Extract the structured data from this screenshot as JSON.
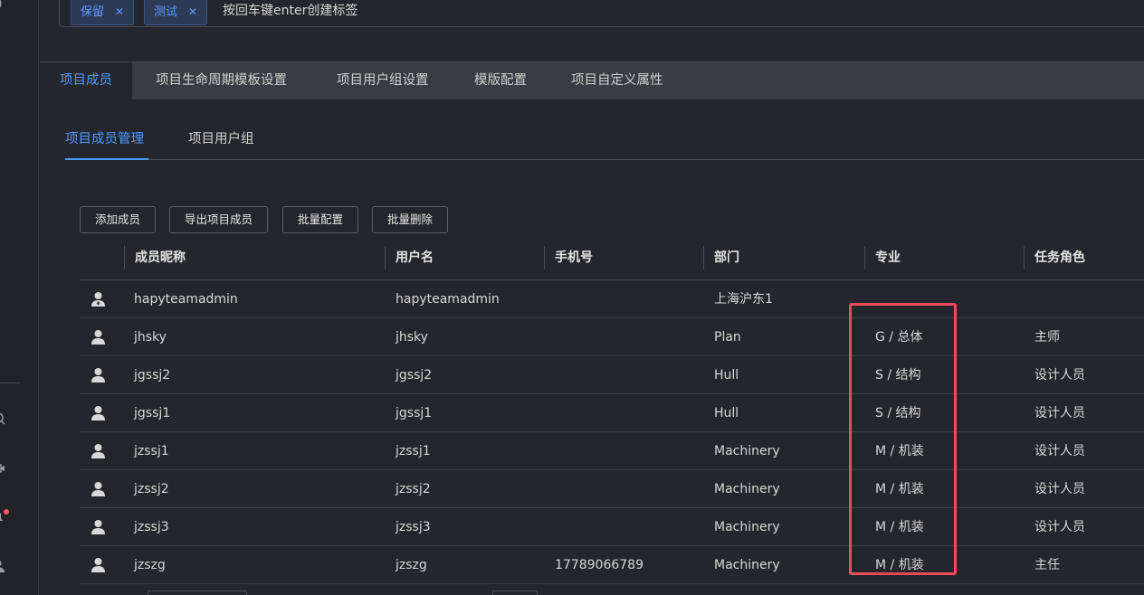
{
  "tags": {
    "items": [
      "保留",
      "测试"
    ],
    "input_placeholder": "按回车键enter创建标签"
  },
  "tabs": [
    "项目成员",
    "项目生命周期模板设置",
    "项目用户组设置",
    "模版配置",
    "项目自定义属性"
  ],
  "subtabs": [
    "项目成员管理",
    "项目用户组"
  ],
  "toolbar": {
    "add": "添加成员",
    "export": "导出项目成员",
    "batch_config": "批量配置",
    "batch_delete": "批量删除"
  },
  "table": {
    "headers": [
      "成员昵称",
      "用户名",
      "手机号",
      "部门",
      "专业",
      "任务角色"
    ],
    "rows": [
      {
        "nickname": "hapyteamadmin",
        "username": "hapyteamadmin",
        "phone": "",
        "dept": "上海沪东1",
        "major": "",
        "role": "",
        "icon": "admin-user-icon"
      },
      {
        "nickname": "jhsky",
        "username": "jhsky",
        "phone": "",
        "dept": "Plan",
        "major": "G / 总体",
        "role": "主师",
        "icon": "user-icon"
      },
      {
        "nickname": "jgssj2",
        "username": "jgssj2",
        "phone": "",
        "dept": "Hull",
        "major": "S / 结构",
        "role": "设计人员",
        "icon": "user-icon"
      },
      {
        "nickname": "jgssj1",
        "username": "jgssj1",
        "phone": "",
        "dept": "Hull",
        "major": "S / 结构",
        "role": "设计人员",
        "icon": "user-icon"
      },
      {
        "nickname": "jzssj1",
        "username": "jzssj1",
        "phone": "",
        "dept": "Machinery",
        "major": "M / 机装",
        "role": "设计人员",
        "icon": "user-icon"
      },
      {
        "nickname": "jzssj2",
        "username": "jzssj2",
        "phone": "",
        "dept": "Machinery",
        "major": "M / 机装",
        "role": "设计人员",
        "icon": "user-icon"
      },
      {
        "nickname": "jzssj3",
        "username": "jzssj3",
        "phone": "",
        "dept": "Machinery",
        "major": "M / 机装",
        "role": "设计人员",
        "icon": "user-icon"
      },
      {
        "nickname": "jzszg",
        "username": "jzszg",
        "phone": "17789066789",
        "dept": "Machinery",
        "major": "M / 机装",
        "role": "主任",
        "icon": "user-icon"
      }
    ]
  },
  "colors": {
    "accent": "#4e9bff",
    "highlight": "#f04a5a",
    "background": "#25262d",
    "tabbar": "#3a3b43"
  }
}
